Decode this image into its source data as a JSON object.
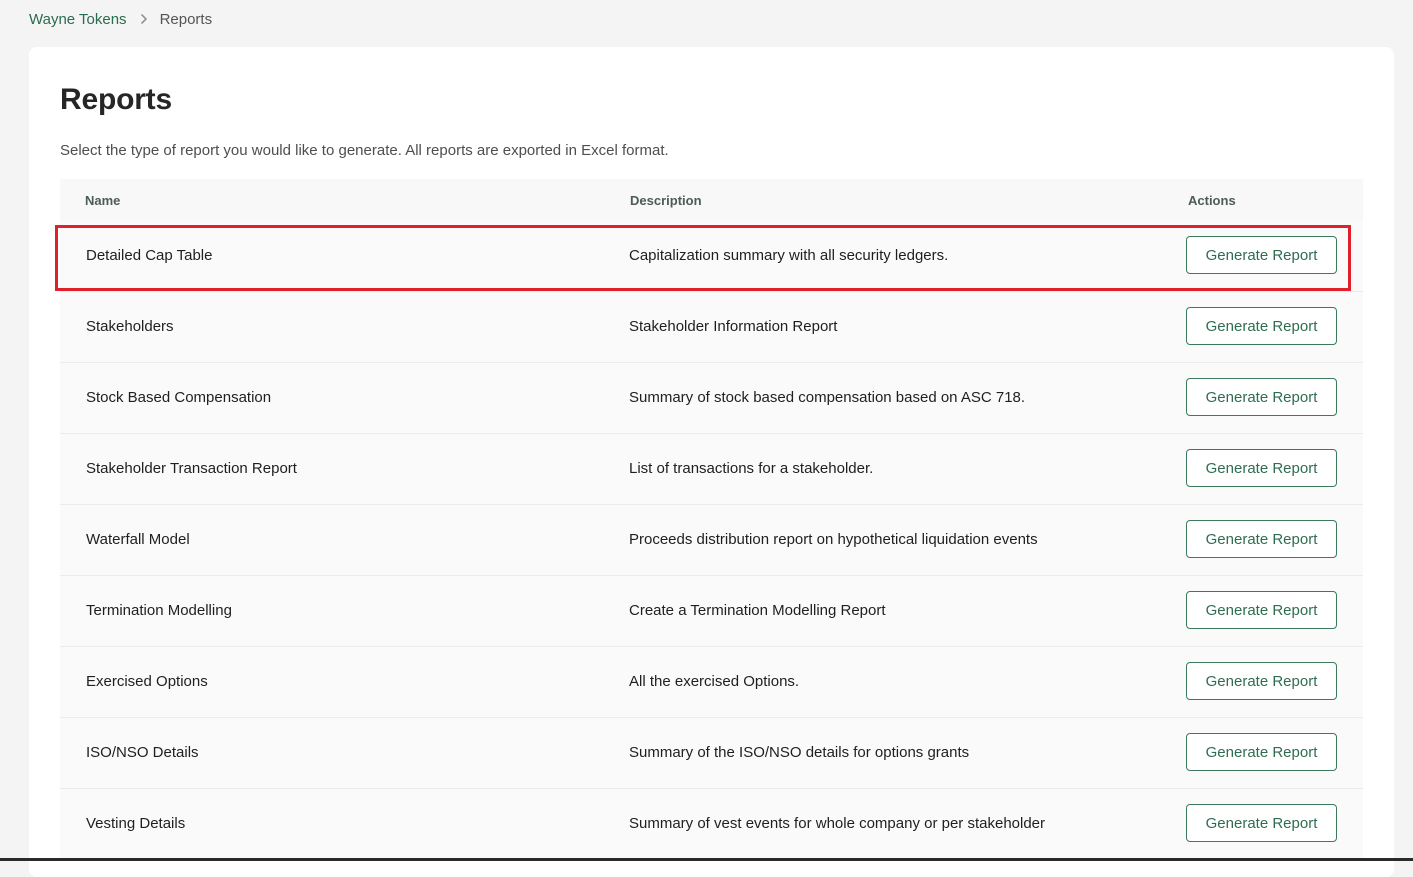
{
  "breadcrumb": {
    "parent": "Wayne Tokens",
    "current": "Reports"
  },
  "page": {
    "title": "Reports",
    "subtitle": "Select the type of report you would like to generate. All reports are exported in Excel format."
  },
  "table": {
    "headers": {
      "name": "Name",
      "description": "Description",
      "actions": "Actions"
    },
    "rows": [
      {
        "name": "Detailed Cap Table",
        "description": "Capitalization summary with all security ledgers.",
        "action": "Generate Report"
      },
      {
        "name": "Stakeholders",
        "description": "Stakeholder Information Report",
        "action": "Generate Report"
      },
      {
        "name": "Stock Based Compensation",
        "description": "Summary of stock based compensation based on ASC 718.",
        "action": "Generate Report"
      },
      {
        "name": "Stakeholder Transaction Report",
        "description": "List of transactions for a stakeholder.",
        "action": "Generate Report"
      },
      {
        "name": "Waterfall Model",
        "description": "Proceeds distribution report on hypothetical liquidation events",
        "action": "Generate Report"
      },
      {
        "name": "Termination Modelling",
        "description": "Create a Termination Modelling Report",
        "action": "Generate Report"
      },
      {
        "name": "Exercised Options",
        "description": "All the exercised Options.",
        "action": "Generate Report"
      },
      {
        "name": "ISO/NSO Details",
        "description": "Summary of the ISO/NSO details for options grants",
        "action": "Generate Report"
      },
      {
        "name": "Vesting Details",
        "description": "Summary of vest events for whole company or per stakeholder",
        "action": "Generate Report"
      }
    ]
  },
  "colors": {
    "accent": "#2f6d51",
    "highlight": "#e0202a"
  },
  "icons": {
    "breadcrumb_separator": "chevron-right-icon"
  }
}
